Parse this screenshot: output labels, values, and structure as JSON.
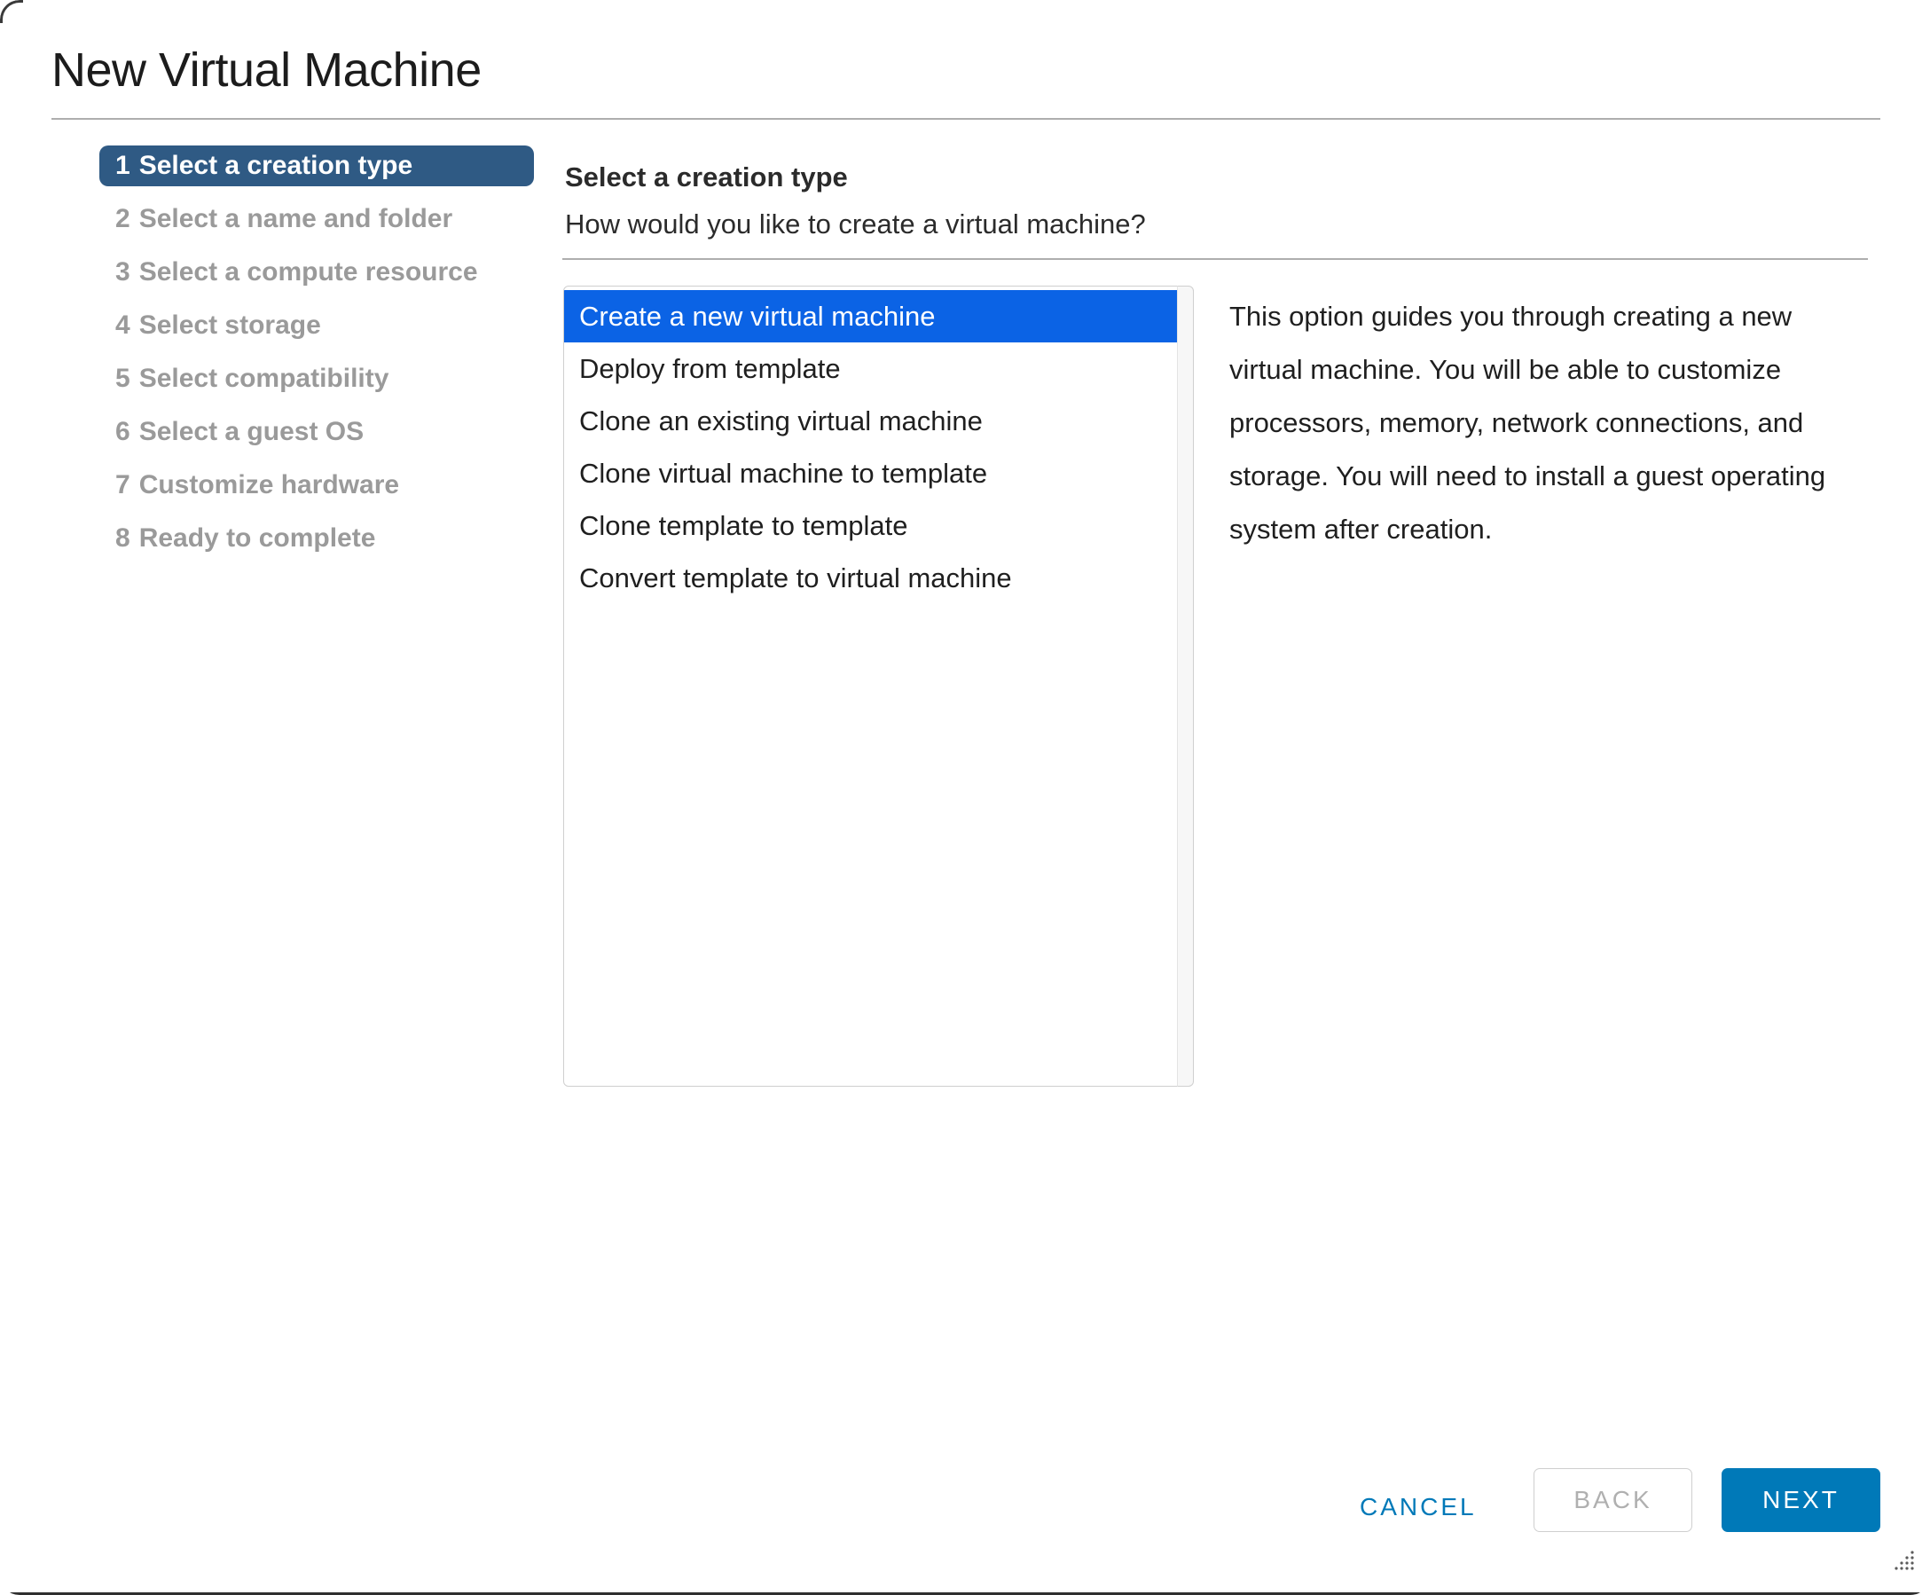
{
  "window": {
    "title": "New Virtual Machine",
    "resize_grip_icon": "resize-grip-icon"
  },
  "wizard": {
    "steps": [
      {
        "num": "1",
        "label": "Select a creation type",
        "active": true
      },
      {
        "num": "2",
        "label": "Select a name and folder",
        "active": false
      },
      {
        "num": "3",
        "label": "Select a compute resource",
        "active": false
      },
      {
        "num": "4",
        "label": "Select storage",
        "active": false
      },
      {
        "num": "5",
        "label": "Select compatibility",
        "active": false
      },
      {
        "num": "6",
        "label": "Select a guest OS",
        "active": false
      },
      {
        "num": "7",
        "label": "Customize hardware",
        "active": false
      },
      {
        "num": "8",
        "label": "Ready to complete",
        "active": false
      }
    ]
  },
  "main": {
    "heading": "Select a creation type",
    "question": "How would you like to create a virtual machine?",
    "creation_types": [
      {
        "label": "Create a new virtual machine",
        "selected": true
      },
      {
        "label": "Deploy from template",
        "selected": false
      },
      {
        "label": "Clone an existing virtual machine",
        "selected": false
      },
      {
        "label": "Clone virtual machine to template",
        "selected": false
      },
      {
        "label": "Clone template to template",
        "selected": false
      },
      {
        "label": "Convert template to virtual machine",
        "selected": false
      }
    ],
    "description": "This option guides you through creating a new virtual machine. You will be able to customize processors, memory, network connections, and storage. You will need to install a guest operating system after creation."
  },
  "footer": {
    "cancel_label": "CANCEL",
    "back_label": "BACK",
    "next_label": "NEXT"
  },
  "colors": {
    "active_step_bg": "#2f5a84",
    "selection_bg": "#0b63e5",
    "primary_button_bg": "#0079b8",
    "link_blue": "#0079b8",
    "muted_text": "#9a9a9a",
    "divider": "#aeaeae"
  }
}
